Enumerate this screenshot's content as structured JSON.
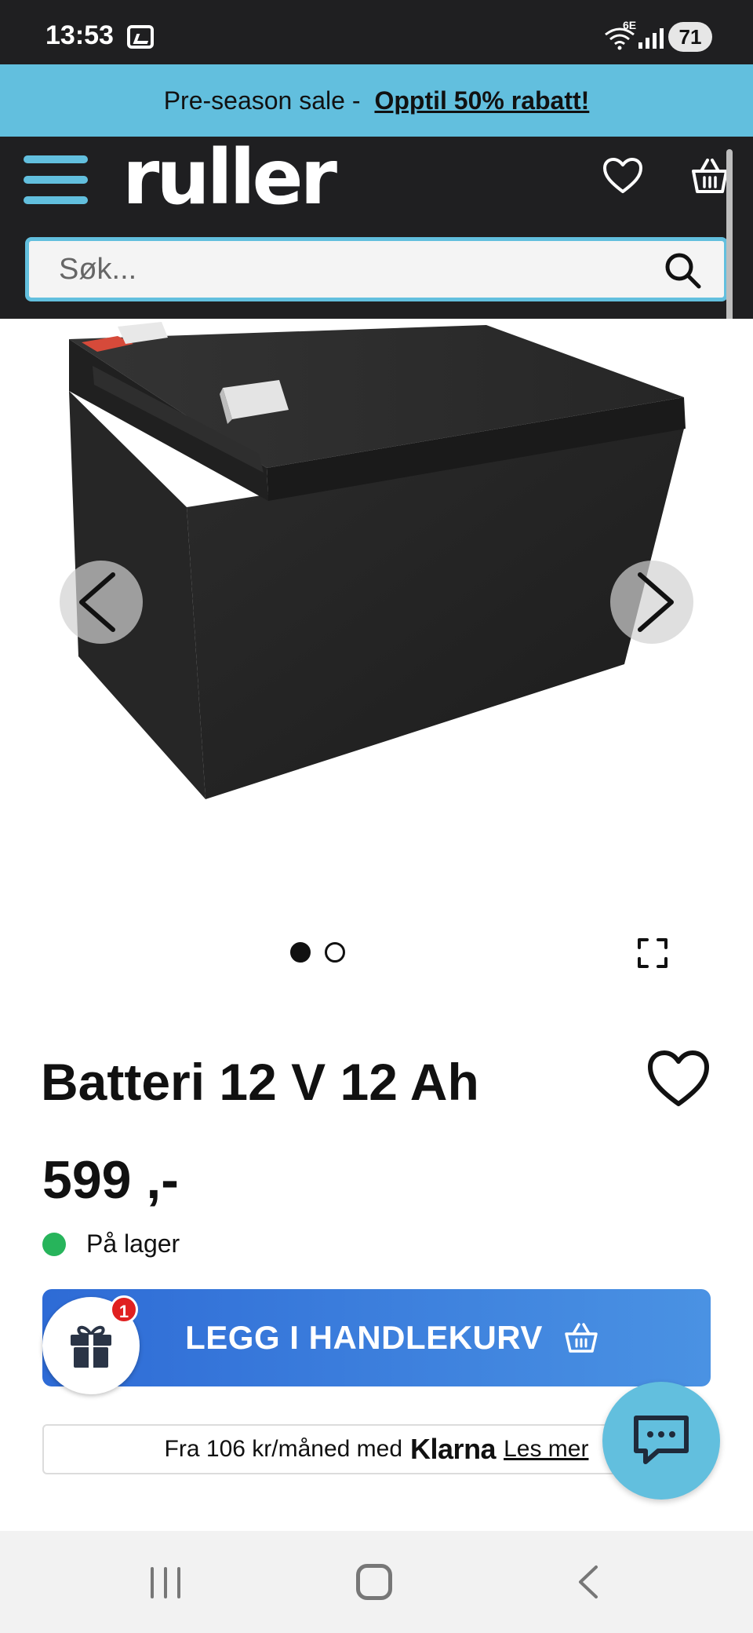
{
  "status_bar": {
    "time": "13:53",
    "network": "6E",
    "battery": "71"
  },
  "promo": {
    "prefix": "Pre-season sale -",
    "link": "Opptil 50% rabatt!"
  },
  "header": {
    "logo": "ruller",
    "search_placeholder": "Søk..."
  },
  "gallery": {
    "image_count": 2,
    "active_index": 0
  },
  "product": {
    "title": "Batteri 12 V 12 Ah",
    "price": "599 ,-",
    "stock": "På lager",
    "add_to_cart": "LEGG I HANDLEKURV",
    "gift_badge": "1"
  },
  "klarna": {
    "prefix": "Fra 106 kr/måned med",
    "brand": "Klarna",
    "link": "Les mer"
  },
  "colors": {
    "accent": "#62bfde",
    "header_bg": "#1f1f21",
    "button_start": "#2e6bd6",
    "button_end": "#4a92e3",
    "in_stock": "#27b45b",
    "badge": "#e02020"
  }
}
